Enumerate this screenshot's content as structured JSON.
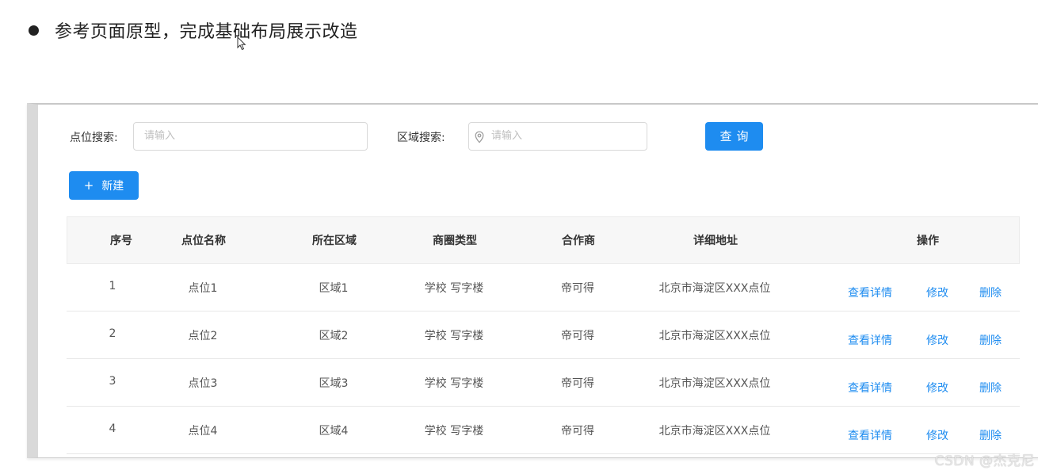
{
  "heading": {
    "text": "参考页面原型，完成基础布局展示改造"
  },
  "search": {
    "point_label": "点位搜索:",
    "point_placeholder": "请输入",
    "area_label": "区域搜索:",
    "area_placeholder": "请输入",
    "query_label": "查询"
  },
  "toolbar": {
    "new_icon": "+",
    "new_label": "新建"
  },
  "table": {
    "columns": [
      "序号",
      "点位名称",
      "所在区域",
      "商圈类型",
      "合作商",
      "详细地址",
      "操作"
    ],
    "rows": [
      {
        "index": "1",
        "name": "点位1",
        "area": "区域1",
        "type": "学校 写字楼",
        "partner": "帝可得",
        "address": "北京市海淀区XXX点位"
      },
      {
        "index": "2",
        "name": "点位2",
        "area": "区域2",
        "type": "学校 写字楼",
        "partner": "帝可得",
        "address": "北京市海淀区XXX点位"
      },
      {
        "index": "3",
        "name": "点位3",
        "area": "区域3",
        "type": "学校 写字楼",
        "partner": "帝可得",
        "address": "北京市海淀区XXX点位"
      },
      {
        "index": "4",
        "name": "点位4",
        "area": "区域4",
        "type": "学校 写字楼",
        "partner": "帝可得",
        "address": "北京市海淀区XXX点位"
      }
    ],
    "actions": {
      "view": "查看详情",
      "edit": "修改",
      "delete": "删除"
    }
  },
  "watermark": "CSDN @杰克尼",
  "colors": {
    "primary": "#1e8cf0"
  },
  "icons": {
    "area_input": "location-pin-icon",
    "cursor": "mouse-cursor-icon"
  }
}
